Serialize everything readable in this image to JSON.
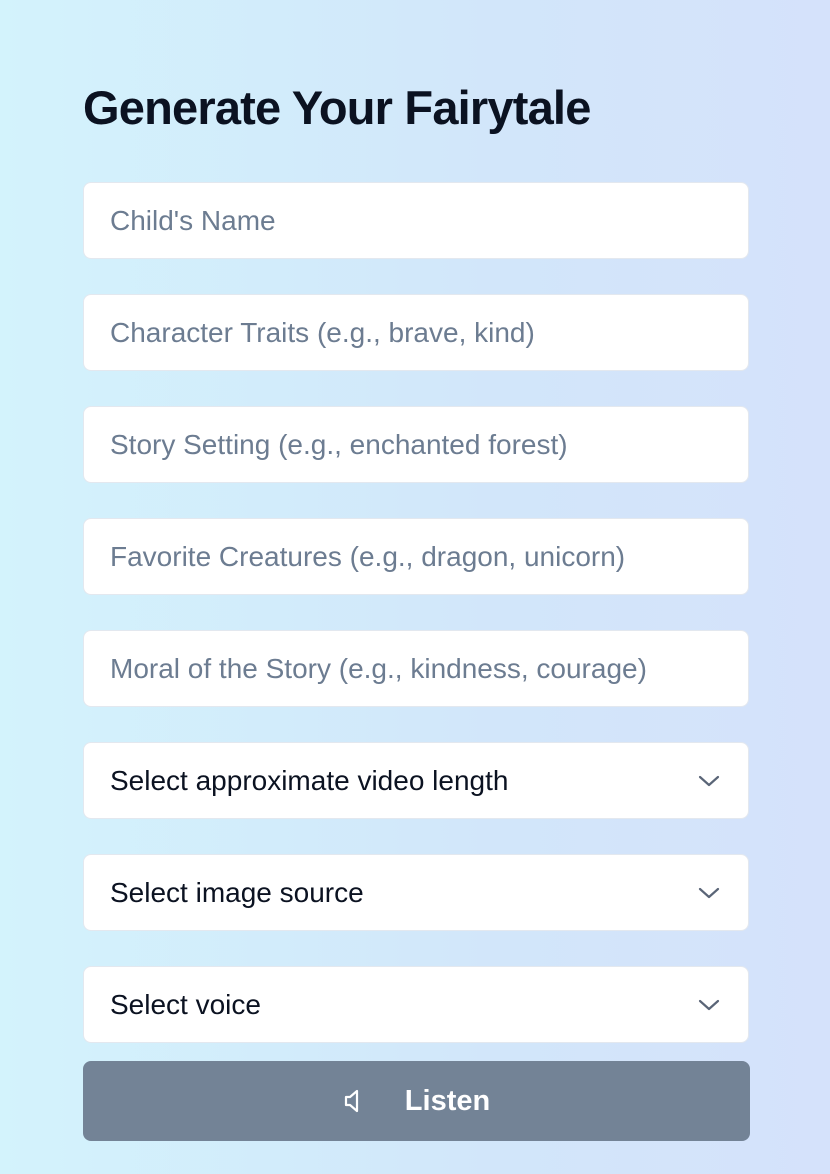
{
  "form": {
    "title": "Generate Your Fairytale",
    "inputs": [
      {
        "placeholder": "Child's Name",
        "value": ""
      },
      {
        "placeholder": "Character Traits (e.g., brave, kind)",
        "value": ""
      },
      {
        "placeholder": "Story Setting (e.g., enchanted forest)",
        "value": ""
      },
      {
        "placeholder": "Favorite Creatures (e.g., dragon, unicorn)",
        "value": ""
      },
      {
        "placeholder": "Moral of the Story (e.g., kindness, courage)",
        "value": ""
      }
    ],
    "selects": [
      {
        "selected": "Select approximate video length"
      },
      {
        "selected": "Select image source"
      },
      {
        "selected": "Select voice"
      }
    ],
    "listen_button": {
      "label": "Listen",
      "icon": "speaker-icon"
    }
  },
  "colors": {
    "title": "#0b1221",
    "placeholder": "#6c7c91",
    "button_bg": "#738396",
    "button_text": "#ffffff",
    "field_bg": "#ffffff"
  }
}
